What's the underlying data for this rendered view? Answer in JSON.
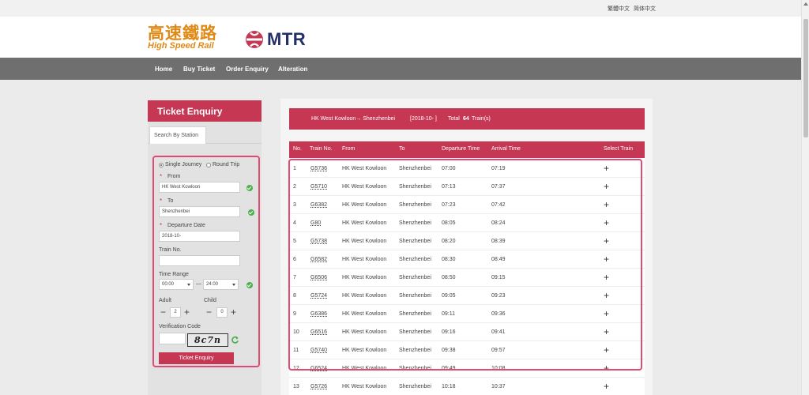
{
  "language_links": [
    "繁體中文",
    "简体中文"
  ],
  "brand": {
    "hsr_chinese": "高速鐵路",
    "hsr_english": "High Speed Rail",
    "mtr_name": "MTR"
  },
  "nav": [
    "Home",
    "Buy Ticket",
    "Order Enquiry",
    "Alteration"
  ],
  "enquiry_panel": {
    "title": "Ticket Enquiry",
    "tab": "Search By Station",
    "journey_options": [
      "Single Journey",
      "Round Trip"
    ],
    "journey_selected": "Single Journey",
    "from_label": "From",
    "from_value": "HK West Kowloon",
    "to_label": "To",
    "to_value": "Shenzhenbei",
    "date_label": "Departure Date",
    "date_value": "2018-10-",
    "train_no_label": "Train No.",
    "train_no_value": "",
    "time_range_label": "Time Range",
    "time_from": "00:00",
    "time_separator": "—",
    "time_to": "24:00",
    "adult_label": "Adult",
    "adult_value": "2",
    "child_label": "Child",
    "child_value": "0",
    "minus_symbol": "−",
    "plus_symbol": "+",
    "verification_label": "Verification Code",
    "verification_value": "",
    "captcha_text": "8c7n",
    "submit_label": "Ticket Enquiry"
  },
  "results": {
    "route": "HK West Kowloon→ Shenzhenbei",
    "date": "[2018-10-     ]",
    "total_prefix": "Total",
    "total_count": "64",
    "total_suffix": "Train(s)",
    "headers": [
      "No.",
      "Train No.",
      "From",
      "To",
      "Departure Time",
      "Arrival Time",
      "Select Train"
    ],
    "select_symbol": "+",
    "rows": [
      [
        "1",
        "G5736",
        "HK West Kowloon",
        "Shenzhenbei",
        "07:00",
        "07:19"
      ],
      [
        "2",
        "G5710",
        "HK West Kowloon",
        "Shenzhenbei",
        "07:13",
        "07:37"
      ],
      [
        "3",
        "G6382",
        "HK West Kowloon",
        "Shenzhenbei",
        "07:23",
        "07:42"
      ],
      [
        "4",
        "G80",
        "HK West Kowloon",
        "Shenzhenbei",
        "08:05",
        "08:24"
      ],
      [
        "5",
        "G5738",
        "HK West Kowloon",
        "Shenzhenbei",
        "08:20",
        "08:39"
      ],
      [
        "6",
        "G6582",
        "HK West Kowloon",
        "Shenzhenbei",
        "08:30",
        "08:49"
      ],
      [
        "7",
        "G6506",
        "HK West Kowloon",
        "Shenzhenbei",
        "08:50",
        "09:15"
      ],
      [
        "8",
        "G5724",
        "HK West Kowloon",
        "Shenzhenbei",
        "09:05",
        "09:23"
      ],
      [
        "9",
        "G6386",
        "HK West Kowloon",
        "Shenzhenbei",
        "09:11",
        "09:36"
      ],
      [
        "10",
        "G6516",
        "HK West Kowloon",
        "Shenzhenbei",
        "09:16",
        "09:41"
      ],
      [
        "11",
        "G5740",
        "HK West Kowloon",
        "Shenzhenbei",
        "09:38",
        "09:57"
      ],
      [
        "12",
        "G6524",
        "HK West Kowloon",
        "Shenzhenbei",
        "09:49",
        "10:08"
      ],
      [
        "13",
        "G5726",
        "HK West Kowloon",
        "Shenzhenbei",
        "10:18",
        "10:37"
      ]
    ]
  },
  "colors": {
    "brand_red": "#c63754",
    "highlight_pink": "#e14a73",
    "nav_gray": "#6f6f6f",
    "hsr_orange": "#e08a16",
    "mtr_navy": "#233066"
  }
}
